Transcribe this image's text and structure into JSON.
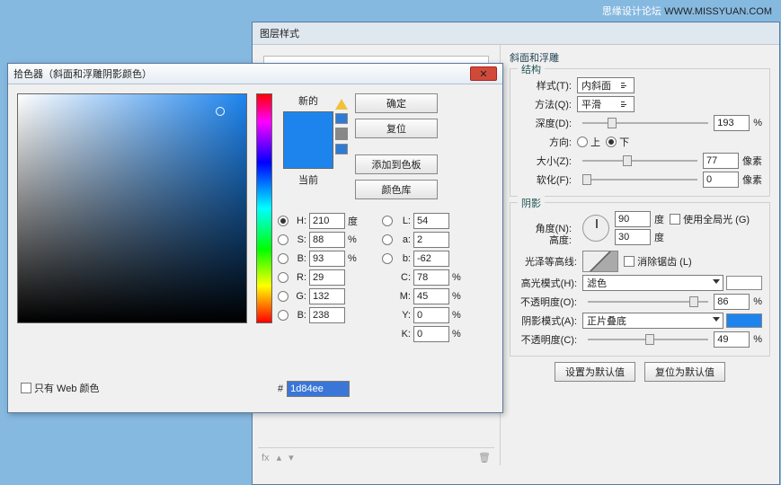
{
  "watermark": {
    "ch": "思缘设计论坛",
    "en": "WWW.MISSYUAN.COM"
  },
  "layerStyle": {
    "title": "图层样式",
    "bevel": {
      "group": "斜面和浮雕",
      "struct": "结构",
      "styleL": "样式(T):",
      "styleV": "内斜面",
      "methodL": "方法(Q):",
      "methodV": "平滑",
      "depthL": "深度(D):",
      "depthV": "193",
      "depthU": "%",
      "dirL": "方向:",
      "up": "上",
      "down": "下",
      "sizeL": "大小(Z):",
      "sizeV": "77",
      "sizeU": "像素",
      "softL": "软化(F):",
      "softV": "0",
      "softU": "像素"
    },
    "shadow": {
      "group": "阴影",
      "angleL": "角度(N):",
      "angleV": "90",
      "angleU": "度",
      "globalL": "使用全局光 (G)",
      "altL": "高度:",
      "altV": "30",
      "altU": "度",
      "glossL": "光泽等高线:",
      "antiL": "消除锯齿 (L)",
      "hmL": "高光模式(H):",
      "hmV": "滤色",
      "hmC": "#ffffff",
      "hoL": "不透明度(O):",
      "hoV": "86",
      "hoU": "%",
      "smL": "阴影模式(A):",
      "smV": "正片叠底",
      "smC": "#1d84ee",
      "soL": "不透明度(C):",
      "soV": "49",
      "soU": "%"
    },
    "footer": {
      "default": "设置为默认值",
      "reset": "复位为默认值",
      "fx": "fx"
    }
  },
  "picker": {
    "title": "拾色器（斜面和浮雕阴影颜色）",
    "new": "新的",
    "current": "当前",
    "ok": "确定",
    "cancel": "复位",
    "add": "添加到色板",
    "lib": "颜色库",
    "H": "210",
    "S": "88",
    "Bv": "93",
    "L": "54",
    "a": "2",
    "b": "-62",
    "R": "29",
    "G": "132",
    "Bl": "238",
    "C": "78",
    "M": "45",
    "Y": "0",
    "K": "0",
    "deg": "度",
    "pct": "%",
    "hash": "#",
    "hex": "1d84ee",
    "web": "只有 Web 颜色",
    "labels": {
      "H": "H:",
      "S": "S:",
      "B": "B:",
      "L": "L:",
      "a": "a:",
      "b": "b:",
      "R": "R:",
      "G": "G:",
      "Bl": "B:",
      "C": "C:",
      "M": "M:",
      "Y": "Y:",
      "K": "K:"
    }
  }
}
